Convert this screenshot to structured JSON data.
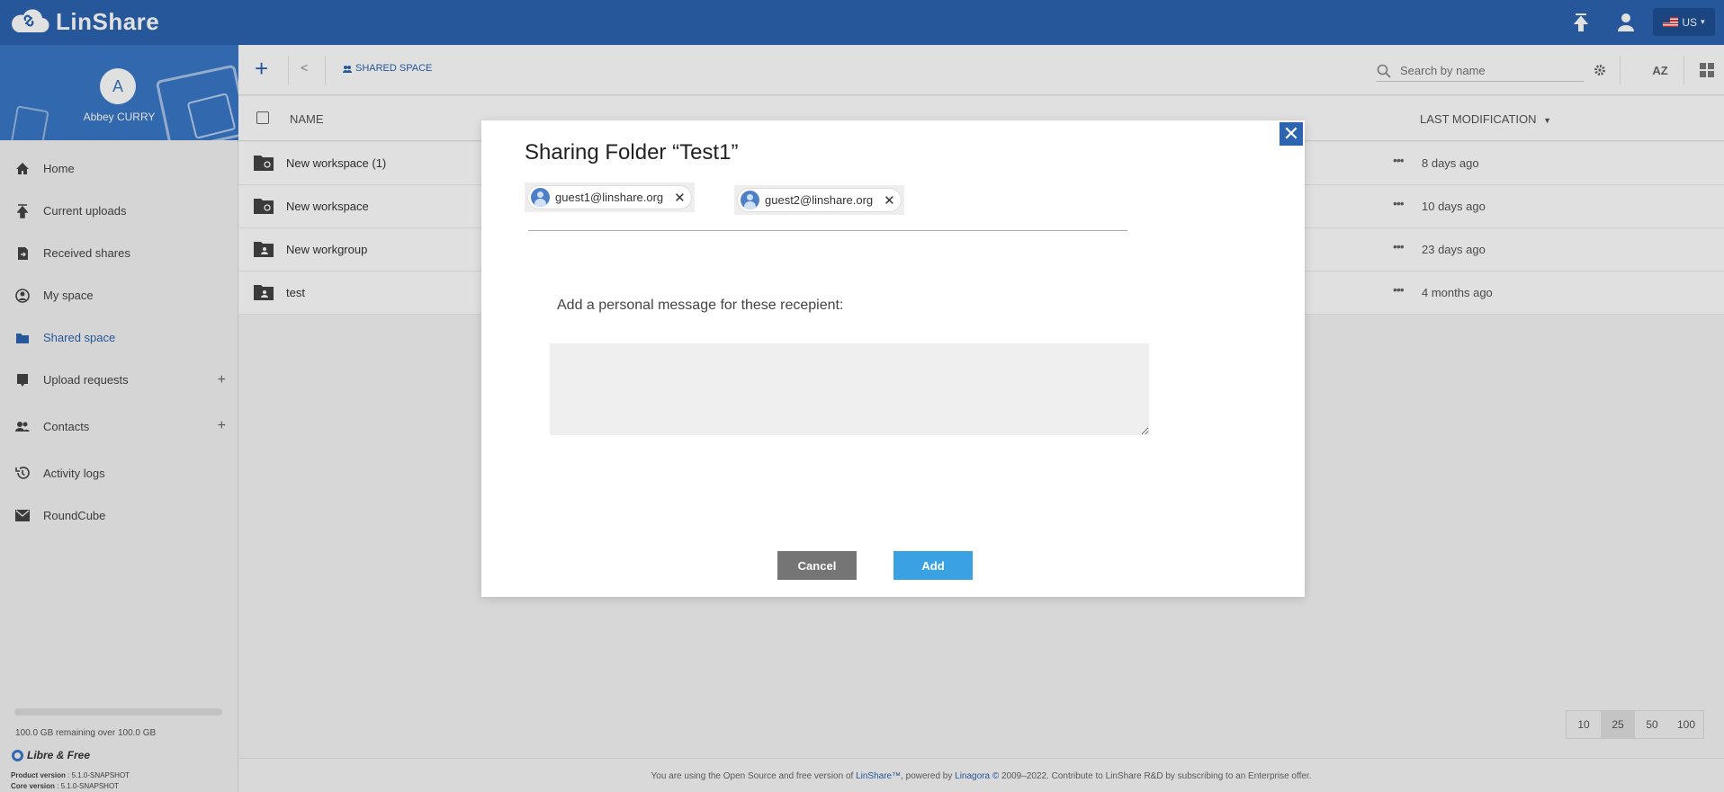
{
  "app": {
    "name": "LinShare",
    "language": "US"
  },
  "user": {
    "initial": "A",
    "name": "Abbey CURRY"
  },
  "sidebar": {
    "items": [
      {
        "label": "Home",
        "icon": "home-icon"
      },
      {
        "label": "Current uploads",
        "icon": "upload-icon"
      },
      {
        "label": "Received shares",
        "icon": "received-shares-icon"
      },
      {
        "label": "My space",
        "icon": "my-space-icon"
      },
      {
        "label": "Shared space",
        "icon": "shared-space-icon",
        "active": true
      },
      {
        "label": "Upload requests",
        "icon": "upload-request-icon",
        "plus": "+"
      },
      {
        "label": "Contacts",
        "icon": "contacts-icon",
        "plus": "+"
      },
      {
        "label": "Activity logs",
        "icon": "history-icon"
      },
      {
        "label": "RoundCube",
        "icon": "mail-icon"
      }
    ],
    "quota_text": "100.0 GB remaining over 100.0 GB",
    "quota_used_fraction": 0.0,
    "libre_label": "Libre & Free",
    "product_version_label": "Product version",
    "product_version": ": 5.1.0-SNAPSHOT",
    "core_version_label": "Core version",
    "core_version": ": 5.1.0-SNAPSHOT"
  },
  "toolbar": {
    "add_label": "+",
    "back_label": "<",
    "breadcrumb": "SHARED SPACE",
    "search_placeholder": "Search by name",
    "sort_label": "AZ"
  },
  "list": {
    "col_name": "NAME",
    "col_modified": "LAST MODIFICATION",
    "rows": [
      {
        "name": "New workspace (1)",
        "date": "8 days ago",
        "type": "workspace"
      },
      {
        "name": "New workspace",
        "date": "10 days ago",
        "type": "workspace"
      },
      {
        "name": "New workgroup",
        "date": "23 days ago",
        "type": "workgroup"
      },
      {
        "name": "test",
        "date": "4 months ago",
        "type": "workgroup"
      }
    ],
    "dots": "•••"
  },
  "pager": {
    "options": [
      "10",
      "25",
      "50",
      "100"
    ],
    "selected": "25"
  },
  "footer": {
    "pre": "You are using the Open Source and free version of ",
    "link1": "LinShare™",
    "mid": ", powered by ",
    "link2": "Linagora ©",
    "post": " 2009–2022. Contribute to LinShare R&D by subscribing to an Enterprise offer."
  },
  "modal": {
    "title": "Sharing Folder “Test1”",
    "recipients": [
      "guest1@linshare.org",
      "guest2@linshare.org"
    ],
    "message_label": "Add a personal message for these recepient:",
    "message_value": "",
    "cancel_label": "Cancel",
    "add_label": "Add",
    "close_label": "✕"
  },
  "colors": {
    "brand": "#2c64b0",
    "add_button": "#3aa2e3",
    "cancel_button": "#757575"
  }
}
